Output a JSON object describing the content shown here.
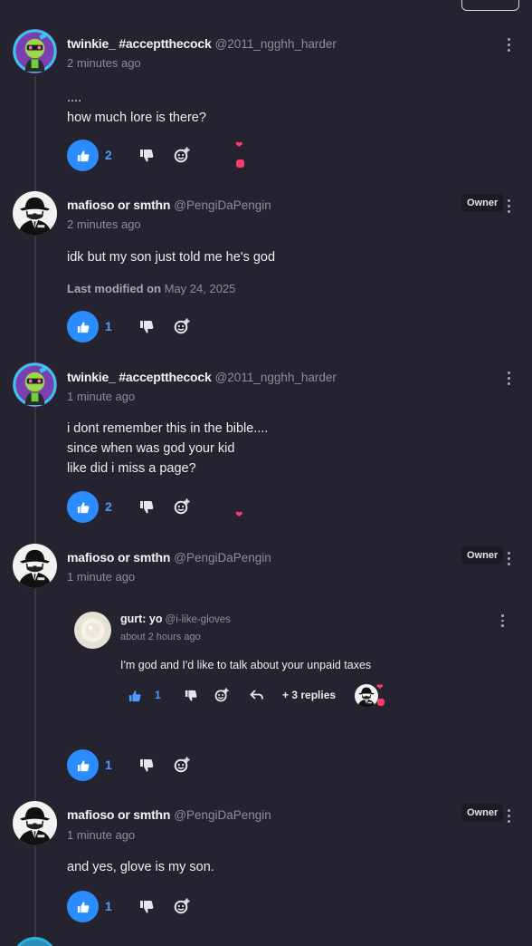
{
  "colors": {
    "background": "#252330",
    "accent": "#2b8cff",
    "muted": "#8f8d9a",
    "reaction_heart": "#ff3b6b"
  },
  "comments": [
    {
      "author": "twinkie_ #acceptthecock",
      "handle": "@2011_ngghh_harder",
      "time": "2 minutes ago",
      "text": "....\nhow much lore is there?",
      "likes": "2",
      "avatar_icon": "green-character-avatar",
      "reactions": [
        "heart",
        "blob"
      ]
    },
    {
      "author": "mafioso or smthn",
      "handle": "@PengiDaPengin",
      "badge": "Owner",
      "time": "2 minutes ago",
      "text": "idk but my son just told me he's god",
      "modified_label": "Last modified on",
      "modified_date": "May 24, 2025",
      "likes": "1",
      "avatar_icon": "mafioso-avatar"
    },
    {
      "author": "twinkie_ #acceptthecock",
      "handle": "@2011_ngghh_harder",
      "time": "1 minute ago",
      "text": "i dont remember this in the bible....\nsince when was god your kid\nlike did i miss a page?",
      "likes": "2",
      "avatar_icon": "green-character-avatar",
      "reactions": [
        "heart"
      ]
    },
    {
      "author": "mafioso or smthn",
      "handle": "@PengiDaPengin",
      "badge": "Owner",
      "time": "1 minute ago",
      "likes": "1",
      "avatar_icon": "mafioso-avatar",
      "quoted_reply": {
        "author": "gurt: yo",
        "handle": "@i-like-gloves",
        "time": "about 2 hours ago",
        "text": "I'm god and I'd like to talk about your unpaid taxes",
        "likes": "1",
        "replies_label": "+ 3 replies",
        "avatar_icon": "glove-avatar"
      }
    },
    {
      "author": "mafioso or smthn",
      "handle": "@PengiDaPengin",
      "badge": "Owner",
      "time": "1 minute ago",
      "text": "and yes, glove is my son.",
      "likes": "1",
      "avatar_icon": "mafioso-avatar"
    }
  ]
}
